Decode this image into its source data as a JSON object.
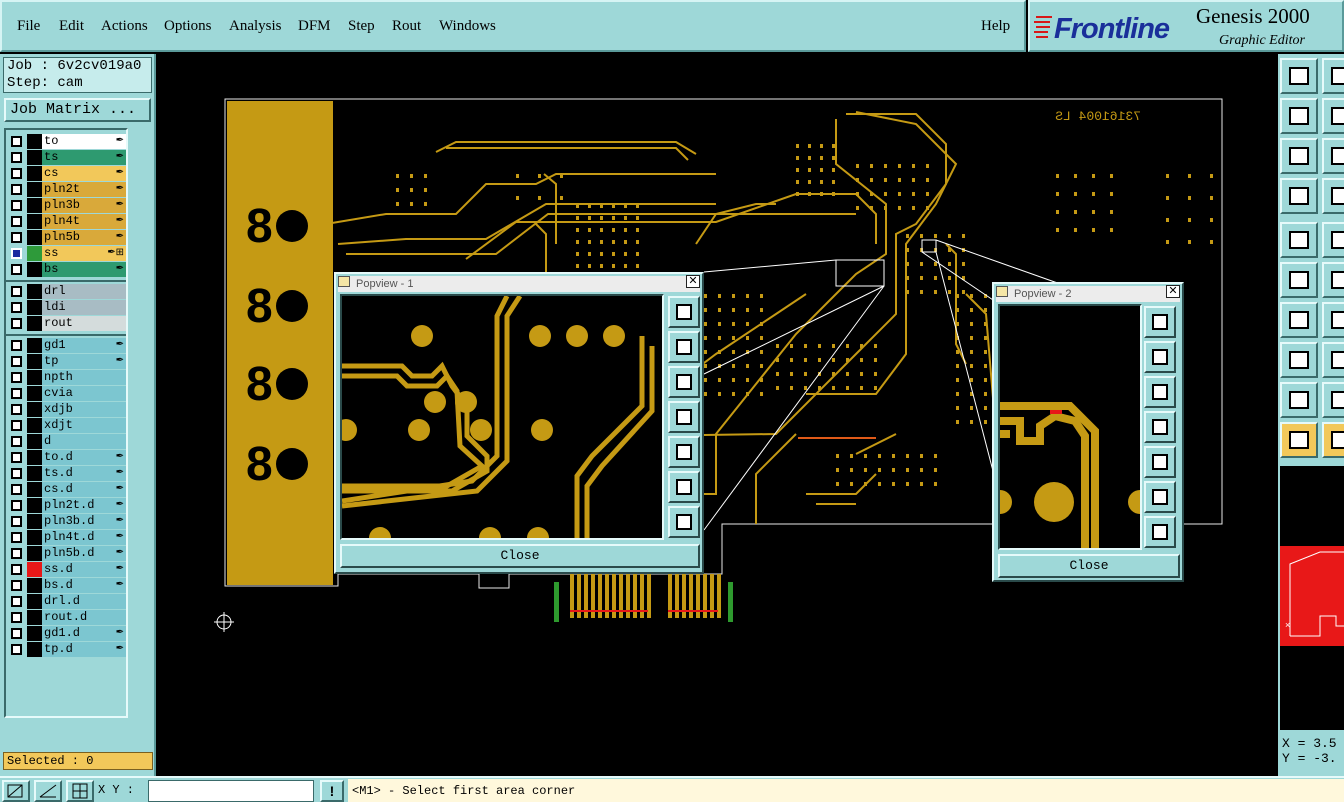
{
  "menu": {
    "items": [
      "File",
      "Edit",
      "Actions",
      "Options",
      "Analysis",
      "DFM",
      "Step",
      "Rout",
      "Windows"
    ],
    "help": "Help"
  },
  "brand": {
    "logo_text": "Frontline",
    "product": "Genesis 2000",
    "subtitle": "Graphic Editor"
  },
  "job": {
    "job_line": "Job : 6v2cv019a0",
    "step_line": "Step: cam",
    "matrix_button": "Job Matrix ..."
  },
  "layers": [
    {
      "name": "to",
      "color": "#ffffff",
      "swatch": "#000000",
      "mark": "✒"
    },
    {
      "name": "ts",
      "color": "#2e9a70",
      "swatch": "#000000",
      "mark": "✒"
    },
    {
      "name": "cs",
      "color": "#f2c85a",
      "swatch": "#000000",
      "mark": "✒"
    },
    {
      "name": "pln2t",
      "color": "#d9a93a",
      "swatch": "#000000",
      "mark": "✒"
    },
    {
      "name": "pln3b",
      "color": "#d9a93a",
      "swatch": "#000000",
      "mark": "✒"
    },
    {
      "name": "pln4t",
      "color": "#d9a93a",
      "swatch": "#000000",
      "mark": "✒"
    },
    {
      "name": "pln5b",
      "color": "#d9a93a",
      "swatch": "#000000",
      "mark": "✒"
    },
    {
      "name": "ss",
      "color": "#f2c85a",
      "swatch": "#2e9a3a",
      "mark": "✒⊞",
      "selected": true
    },
    {
      "name": "bs",
      "color": "#2e9a70",
      "swatch": "#000000",
      "mark": "✒"
    },
    {
      "name": "drl",
      "color": "#a8bcc4",
      "swatch": "#000000",
      "mark": ""
    },
    {
      "name": "ldi",
      "color": "#a8bcc4",
      "swatch": "#000000",
      "mark": ""
    },
    {
      "name": "rout",
      "color": "#d4dcdc",
      "swatch": "#000000",
      "mark": ""
    },
    {
      "name": "gd1",
      "color": "#7cc6d0",
      "swatch": "#000000",
      "mark": "✒"
    },
    {
      "name": "tp",
      "color": "#7cc6d0",
      "swatch": "#000000",
      "mark": "✒"
    },
    {
      "name": "npth",
      "color": "#7cc6d0",
      "swatch": "#000000",
      "mark": ""
    },
    {
      "name": "cvia",
      "color": "#7cc6d0",
      "swatch": "#000000",
      "mark": ""
    },
    {
      "name": "xdjb",
      "color": "#7cc6d0",
      "swatch": "#000000",
      "mark": ""
    },
    {
      "name": "xdjt",
      "color": "#7cc6d0",
      "swatch": "#000000",
      "mark": ""
    },
    {
      "name": "d",
      "color": "#7cc6d0",
      "swatch": "#000000",
      "mark": ""
    },
    {
      "name": "to.d",
      "color": "#7cc6d0",
      "swatch": "#000000",
      "mark": "✒"
    },
    {
      "name": "ts.d",
      "color": "#7cc6d0",
      "swatch": "#000000",
      "mark": "✒"
    },
    {
      "name": "cs.d",
      "color": "#7cc6d0",
      "swatch": "#000000",
      "mark": "✒"
    },
    {
      "name": "pln2t.d",
      "color": "#7cc6d0",
      "swatch": "#000000",
      "mark": "✒"
    },
    {
      "name": "pln3b.d",
      "color": "#7cc6d0",
      "swatch": "#000000",
      "mark": "✒"
    },
    {
      "name": "pln4t.d",
      "color": "#7cc6d0",
      "swatch": "#000000",
      "mark": "✒"
    },
    {
      "name": "pln5b.d",
      "color": "#7cc6d0",
      "swatch": "#000000",
      "mark": "✒"
    },
    {
      "name": "ss.d",
      "color": "#7cc6d0",
      "swatch": "#e81818",
      "mark": "✒"
    },
    {
      "name": "bs.d",
      "color": "#7cc6d0",
      "swatch": "#000000",
      "mark": "✒"
    },
    {
      "name": "drl.d",
      "color": "#7cc6d0",
      "swatch": "#000000",
      "mark": ""
    },
    {
      "name": "rout.d",
      "color": "#7cc6d0",
      "swatch": "#000000",
      "mark": ""
    },
    {
      "name": "gd1.d",
      "color": "#7cc6d0",
      "swatch": "#000000",
      "mark": "✒"
    },
    {
      "name": "tp.d",
      "color": "#7cc6d0",
      "swatch": "#000000",
      "mark": "✒"
    }
  ],
  "selected_label": "Selected : 0",
  "bottom": {
    "xy_label": "X Y :",
    "xy_value": "",
    "warn": "!",
    "status": "<M1> - Select first area corner"
  },
  "board": {
    "mirror_text": "73161004 LS"
  },
  "popview1": {
    "title": "Popview - 1",
    "close": "Close"
  },
  "popview2": {
    "title": "Popview - 2",
    "close": "Close"
  },
  "coords": {
    "x": "X = 3.5",
    "y": "Y = -3."
  },
  "colors": {
    "panel": "#9ed8d8",
    "copper": "#c59a14",
    "highlight": "#f2c85a",
    "minimap": "#e81818"
  }
}
